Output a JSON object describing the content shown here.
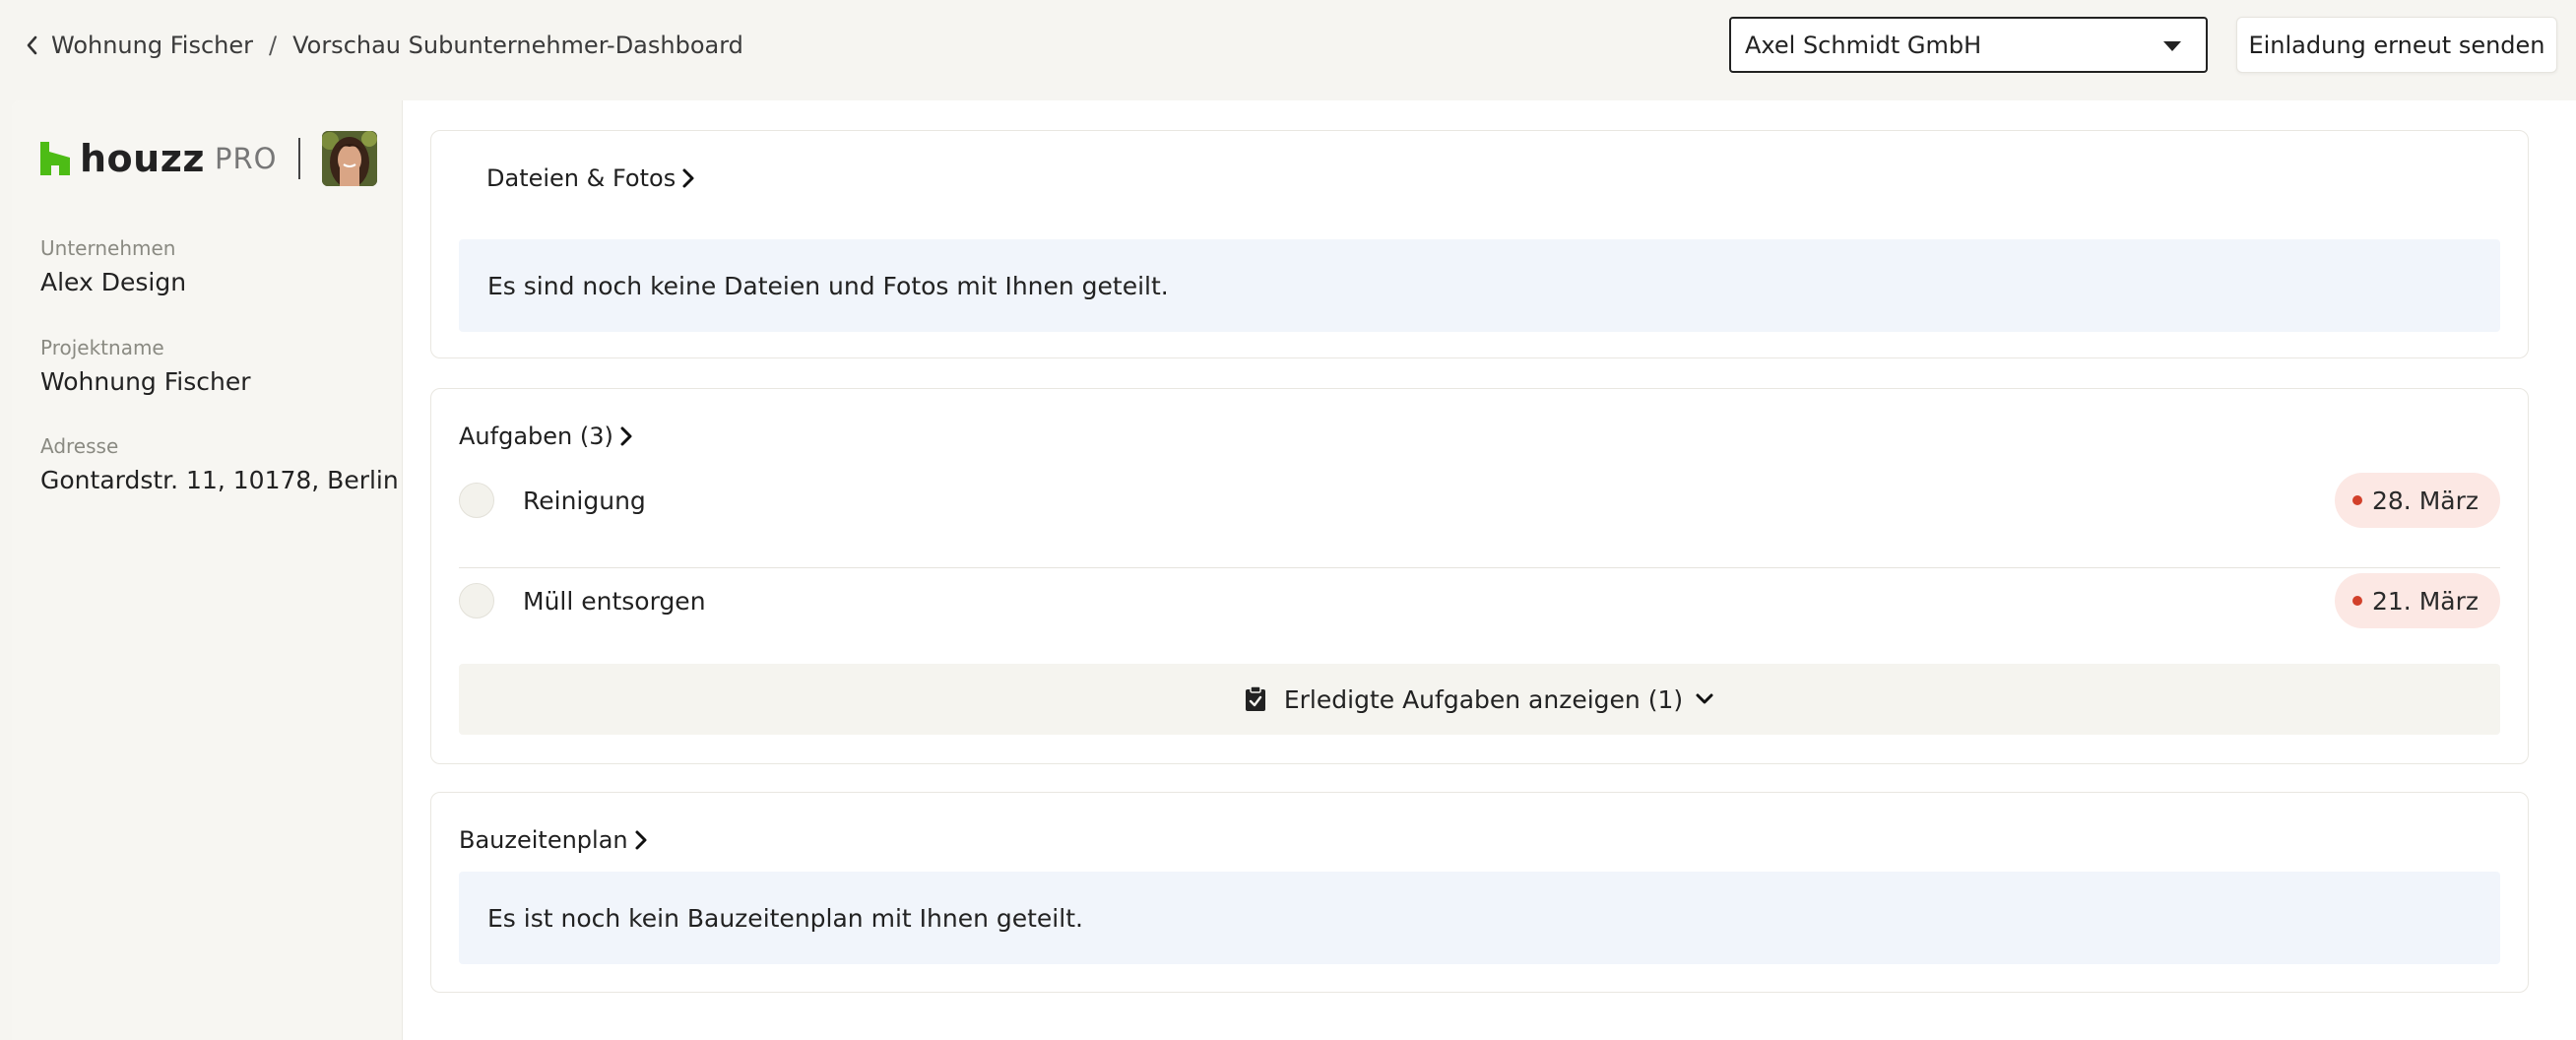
{
  "breadcrumb": {
    "parent": "Wohnung Fischer",
    "separator": "/",
    "current": "Vorschau Subunternehmer-Dashboard"
  },
  "header": {
    "selected_company": "Axel Schmidt GmbH",
    "resend_label": "Einladung erneut senden"
  },
  "brand": {
    "name": "houzz",
    "tier": "PRO"
  },
  "sidebar": {
    "company_label": "Unternehmen",
    "company_value": "Alex Design",
    "project_label": "Projektname",
    "project_value": "Wohnung Fischer",
    "address_label": "Adresse",
    "address_value": "Gontardstr. 11, 10178, Berlin"
  },
  "files": {
    "title": "Dateien & Fotos",
    "empty_text": "Es sind noch keine Dateien und Fotos mit Ihnen geteilt."
  },
  "tasks": {
    "title": "Aufgaben (3)",
    "items": [
      {
        "name": "Reinigung",
        "due": "28. März"
      },
      {
        "name": "Müll entsorgen",
        "due": "21. März"
      }
    ],
    "show_done_label": "Erledigte Aufgaben anzeigen (1)"
  },
  "schedule": {
    "title": "Bauzeitenplan",
    "empty_text": "Es ist noch kein Bauzeitenplan mit Ihnen geteilt."
  },
  "colors": {
    "brand_green": "#4dbc15",
    "page_bg": "#f6f5f1",
    "info_bg": "#f1f5fb",
    "due_badge_bg": "#fce8e4",
    "due_dot": "#d2402a"
  },
  "icons": [
    "chevron-left-icon",
    "caret-down-icon",
    "houzz-logo-icon",
    "chevron-right-icon",
    "clipboard-check-icon",
    "chevron-down-icon"
  ]
}
